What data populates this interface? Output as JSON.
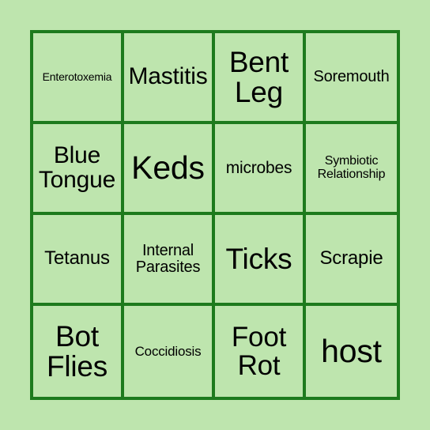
{
  "card": {
    "type": "bingo-card",
    "rows": 4,
    "columns": 4,
    "colors": {
      "background": "#bee5ae",
      "cell_fill": "#bee5ae",
      "grid_line": "#1d7a1d",
      "text": "#000000"
    },
    "cells": [
      {
        "text": "Enterotoxemia",
        "size": "fs-xxs",
        "row": 1,
        "col": 1
      },
      {
        "text": "Mastitis",
        "size": "fs-xl",
        "row": 1,
        "col": 2
      },
      {
        "text": "Bent Leg",
        "size": "fs-4xl",
        "row": 1,
        "col": 3
      },
      {
        "text": "Soremouth",
        "size": "fs-m",
        "row": 1,
        "col": 4
      },
      {
        "text": "Blue Tongue",
        "size": "fs-xl",
        "row": 2,
        "col": 1
      },
      {
        "text": "Keds",
        "size": "fs-5xl",
        "row": 2,
        "col": 2
      },
      {
        "text": "microbes",
        "size": "fs-ml",
        "row": 2,
        "col": 3
      },
      {
        "text": "Symbiotic Relationship",
        "size": "fs-xs",
        "row": 2,
        "col": 4
      },
      {
        "text": "Tetanus",
        "size": "fs-l",
        "row": 3,
        "col": 1
      },
      {
        "text": "Internal Parasites",
        "size": "fs-m",
        "row": 3,
        "col": 2
      },
      {
        "text": "Ticks",
        "size": "fs-4xl",
        "row": 3,
        "col": 3
      },
      {
        "text": "Scrapie",
        "size": "fs-l",
        "row": 3,
        "col": 4
      },
      {
        "text": "Bot Flies",
        "size": "fs-4xl",
        "row": 4,
        "col": 1
      },
      {
        "text": "Coccidiosis",
        "size": "fs-s",
        "row": 4,
        "col": 2
      },
      {
        "text": "Foot Rot",
        "size": "fs-3xl",
        "row": 4,
        "col": 3
      },
      {
        "text": "host",
        "size": "fs-5xl",
        "row": 4,
        "col": 4
      }
    ]
  }
}
